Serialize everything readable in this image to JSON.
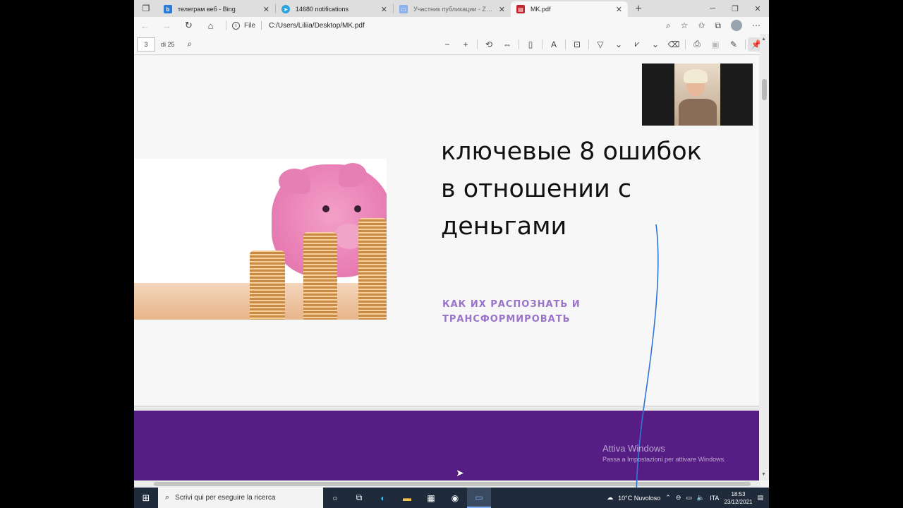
{
  "browser": {
    "tabs": [
      {
        "label": "телеграм веб - Bing",
        "icon_color": "#2a7bd8",
        "icon": "bing-icon"
      },
      {
        "label": "14680 notifications",
        "icon_color": "#2aa3df",
        "icon": "telegram-icon"
      },
      {
        "label": "Участник публикации - Zoom",
        "icon_color": "#8ab0f0",
        "icon": "zoom-icon"
      },
      {
        "label": "MK.pdf",
        "icon_color": "#c4262e",
        "icon": "pdf-icon"
      }
    ],
    "address": {
      "scheme_label": "File",
      "url": "C:/Users/Liliia/Desktop/MK.pdf"
    }
  },
  "pdf_toolbar": {
    "page_number": "3",
    "page_count": "di 25"
  },
  "slide": {
    "title_lines": [
      "ключевые 8 ошибок",
      "в отношении с",
      "деньгами"
    ],
    "subtitle_lines": [
      "КАК ИХ РАСПОЗНАТЬ И",
      "ТРАНСФОРМИРОВАТЬ"
    ],
    "next_page_color": "#561d84",
    "subtitle_color": "#9a74c8"
  },
  "watermark": {
    "line1": "Attiva Windows",
    "line2": "Passa a Impostazioni per attivare Windows."
  },
  "taskbar": {
    "search_placeholder": "Scrivi qui per eseguire la ricerca",
    "weather": "10°C  Nuvoloso",
    "language": "ITA",
    "time": "18:53",
    "date": "23/12/2021"
  }
}
